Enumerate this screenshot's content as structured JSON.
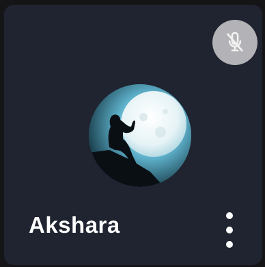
{
  "participant": {
    "name": "Akshara",
    "muted": true
  },
  "icons": {
    "mute": "mic-off-icon",
    "more": "more-vertical-icon"
  },
  "colors": {
    "tile_background": "#1f2430",
    "mute_button": "#b3b3b7",
    "text": "#ffffff"
  }
}
